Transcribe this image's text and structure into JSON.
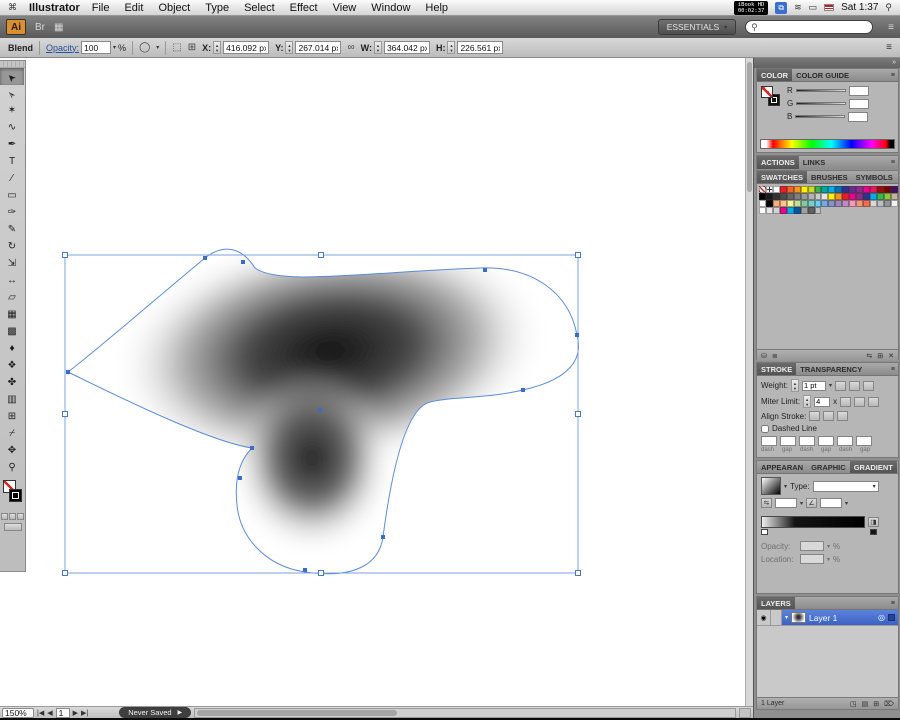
{
  "menubar": {
    "app_name": "Illustrator",
    "items": [
      "File",
      "Edit",
      "Object",
      "Type",
      "Select",
      "Effect",
      "View",
      "Window",
      "Help"
    ],
    "recorder": {
      "line1": "iBook HD",
      "line2": "00:02:37"
    },
    "clock": "Sat 1:37"
  },
  "appbar": {
    "logo": "Ai",
    "workspace": "ESSENTIALS",
    "search_placeholder": ""
  },
  "controlbar": {
    "selection_type": "Blend",
    "opacity": {
      "label": "Opacity:",
      "value": "100",
      "unit": "%"
    },
    "fields": [
      {
        "label": "X:",
        "value": "416.092 px"
      },
      {
        "label": "Y:",
        "value": "267.014 px"
      },
      {
        "label": "W:",
        "value": "364.042 px"
      },
      {
        "label": "H:",
        "value": "226.561 px"
      }
    ]
  },
  "icons": {
    "apple": "⌘",
    "search": "⚲",
    "dropdown": "▾",
    "stepper_up": "▲",
    "stepper_down": "▼",
    "panel_menu": "≡",
    "double_arrow": "»",
    "link": "∞",
    "nav_first": "|◀",
    "nav_prev": "◀",
    "nav_next": "▶",
    "nav_last": "▶|",
    "play": "▶",
    "eye": "◉",
    "target": "◎",
    "trash": "⌦",
    "new_layer": "⊞",
    "folder": "▤",
    "sublayer": "◳",
    "wifi": "≋",
    "display": "⧉",
    "battery": "▭",
    "bridge": "Br",
    "arrange": "▦",
    "style_circle": "◯",
    "reverse": "⇆",
    "angle": "∠",
    "edit_grad": "◨",
    "diamond": "◇",
    "lib": "⛁",
    "menu_sm": "≣",
    "flow": "⇆",
    "new_sw": "⊞",
    "del_sw": "✕",
    "transform_grid": "⬚",
    "reference_point": "⊞"
  },
  "toolbar": {
    "tools": [
      {
        "name": "selection-tool",
        "glyph": "➤",
        "rot": -135,
        "selected": true
      },
      {
        "name": "direct-selection-tool",
        "glyph": "➢",
        "rot": -135
      },
      {
        "name": "magic-wand-tool",
        "glyph": "✶"
      },
      {
        "name": "lasso-tool",
        "glyph": "∿"
      },
      {
        "name": "pen-tool",
        "glyph": "✒"
      },
      {
        "name": "type-tool",
        "glyph": "T"
      },
      {
        "name": "line-segment-tool",
        "glyph": "∕"
      },
      {
        "name": "rectangle-tool",
        "glyph": "▭"
      },
      {
        "name": "paintbrush-tool",
        "glyph": "✑"
      },
      {
        "name": "pencil-tool",
        "glyph": "✎"
      },
      {
        "name": "rotate-tool",
        "glyph": "↻"
      },
      {
        "name": "scale-tool",
        "glyph": "⇲"
      },
      {
        "name": "width-tool",
        "glyph": "↔"
      },
      {
        "name": "free-transform-tool",
        "glyph": "▱"
      },
      {
        "name": "mesh-tool",
        "glyph": "▦"
      },
      {
        "name": "gradient-tool",
        "glyph": "▩"
      },
      {
        "name": "eyedropper-tool",
        "glyph": "♦"
      },
      {
        "name": "blend-tool",
        "glyph": "❖"
      },
      {
        "name": "symbol-sprayer-tool",
        "glyph": "✤"
      },
      {
        "name": "column-graph-tool",
        "glyph": "▥"
      },
      {
        "name": "artboard-tool",
        "glyph": "⊞"
      },
      {
        "name": "slice-tool",
        "glyph": "⌿"
      },
      {
        "name": "hand-tool",
        "glyph": "✥"
      },
      {
        "name": "zoom-tool",
        "glyph": "⚲"
      }
    ]
  },
  "panels": {
    "color": {
      "tab_color": "COLOR",
      "tab_guide": "COLOR GUIDE",
      "channels": [
        "R",
        "G",
        "B"
      ]
    },
    "actions_links": {
      "tab_actions": "ACTIONS",
      "tab_links": "LINKS"
    },
    "swatches": {
      "tab_swatches": "SWATCHES",
      "tab_brushes": "BRUSHES",
      "tab_symbols": "SYMBOLS",
      "rows": [
        [
          "none",
          "registration",
          "#ffffff",
          "#ed1c24",
          "#f26522",
          "#f7941d",
          "#fff200",
          "#cadb2a",
          "#39b54a",
          "#00a99d",
          "#00aeef",
          "#0072bc",
          "#2e3192",
          "#662d91",
          "#92278f",
          "#ec008c",
          "#ed145b",
          "#9e0b0f",
          "#790000",
          "#440e62"
        ],
        [
          "#000000",
          "#1a1a1a",
          "#333333",
          "#4d4d4d",
          "#666666",
          "#808080",
          "#999999",
          "#b3b3b3",
          "#cccccc",
          "#e6e6e6",
          "#fff200",
          "#f7941d",
          "#ed1c24",
          "#ec008c",
          "#92278f",
          "#2e3192",
          "#00aeef",
          "#39b54a",
          "#8dc63f",
          "#c7b299"
        ],
        [
          "#ffffff",
          "#000000",
          "#f9ad81",
          "#fdc689",
          "#fff799",
          "#c4df9b",
          "#82ca9c",
          "#7accc8",
          "#6dcff6",
          "#7da7d9",
          "#8493ca",
          "#a186be",
          "#bd8cbf",
          "#f49ac1",
          "#f69679",
          "#f26c4f",
          "#d9d9d9",
          "#bcbec0",
          "#939598",
          "#f1f2f2"
        ],
        [
          "#ffffff",
          "#e6e7e8",
          "#d1d3d4",
          "#ec008c",
          "#00aeef",
          "#0054a6",
          "#a0a0a0",
          "#606060",
          "#c0c0c0"
        ]
      ]
    },
    "stroke": {
      "tab_stroke": "STROKE",
      "tab_transparency": "TRANSPARENCY",
      "weight_label": "Weight:",
      "weight_value": "1 pt",
      "miter_label": "Miter Limit:",
      "miter_value": "4",
      "miter_unit": "x",
      "align_label": "Align Stroke:",
      "dashed_label": "Dashed Line",
      "dash_labels": [
        "dash",
        "gap",
        "dash",
        "gap",
        "dash",
        "gap"
      ]
    },
    "gradient": {
      "tab_appearance": "APPEARAN",
      "tab_graphic": "GRAPHIC",
      "tab_gradient": "GRADIENT",
      "type_label": "Type:",
      "opacity_label": "Opacity:",
      "opacity_unit": "%",
      "location_label": "Location:",
      "location_unit": "%"
    },
    "layers": {
      "tab": "LAYERS",
      "layer_name": "Layer 1",
      "count": "1 Layer"
    }
  },
  "statusbar": {
    "zoom": "150%",
    "artboard_num": "1",
    "status": "Never Saved"
  },
  "canvas": {
    "selection_color": "#5b8bd8"
  }
}
